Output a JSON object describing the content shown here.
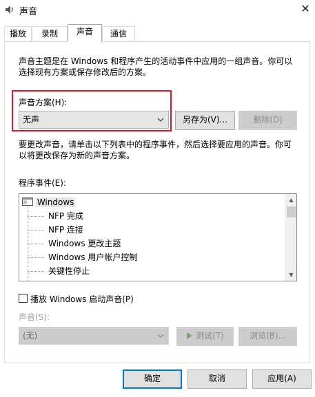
{
  "window": {
    "title": "声音",
    "close_glyph": "✕"
  },
  "tabs": [
    {
      "label": "播放",
      "active": false
    },
    {
      "label": "录制",
      "active": false
    },
    {
      "label": "声音",
      "active": true
    },
    {
      "label": "通信",
      "active": false
    }
  ],
  "intro_text": {
    "line1": "声音主题是在 Windows 和程序产生的活动事件中应用的一组声音。你可以",
    "line2": "选择现有方案或保存修改后的方案。"
  },
  "scheme": {
    "label": "声音方案(H):",
    "value": "无声",
    "save_as_label": "另存为(V)...",
    "delete_label": "删除(D)"
  },
  "change_text": {
    "line1": "要更改声音，请单击以下列表中的程序事件，然后选择要应用的声音。你可",
    "line2": "以将更改保存为新的声音方案。"
  },
  "events": {
    "label": "程序事件(E):",
    "root": "Windows",
    "items": [
      "NFP 完成",
      "NFP 连接",
      "Windows 更改主题",
      "Windows 用户帐户控制",
      "关键性停止"
    ]
  },
  "startup_sound": {
    "label": "播放 Windows 启动声音(P)",
    "checked": false
  },
  "sound": {
    "label": "声音(S):",
    "value": "(无)",
    "test_label": "测试(T)",
    "browse_label": "浏览(B)..."
  },
  "footer": {
    "ok_label": "确定",
    "cancel_label": "取消",
    "apply_label": "应用(A)"
  },
  "colors": {
    "highlight_border": "#e81123",
    "focus_border": "#0078d7"
  }
}
